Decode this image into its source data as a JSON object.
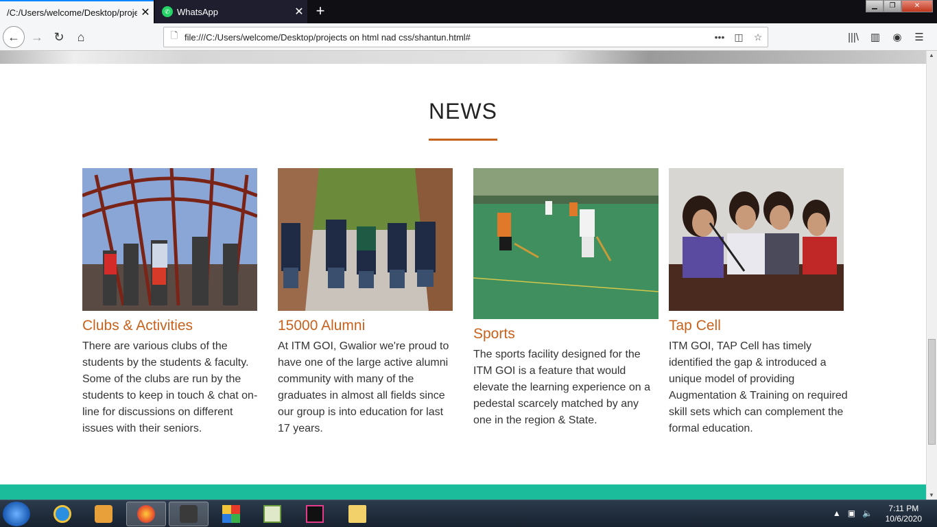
{
  "browser": {
    "tabs": [
      {
        "label": "/C:/Users/welcome/Desktop/projects"
      },
      {
        "label": "WhatsApp"
      }
    ],
    "url": "file:///C:/Users/welcome/Desktop/projects on html nad css/shantun.html#"
  },
  "news": {
    "heading": "NEWS",
    "cards": [
      {
        "title": "Clubs & Activities",
        "text": "There are various clubs of the students by the students & faculty. Some of the clubs are run by the students to keep in touch & chat on-line for discussions on different issues with their seniors."
      },
      {
        "title": "15000 Alumni",
        "text": "At ITM GOI, Gwalior we're proud to have one of the large active alumni community with many of the graduates in almost all fields since our group is into education for last 17 years."
      },
      {
        "title": "Sports",
        "text": "The sports facility designed for the ITM GOI is a feature that would elevate the learning experience on a pedestal scarcely matched by any one in the region & State."
      },
      {
        "title": "Tap Cell",
        "text": "ITM GOI, TAP Cell has timely identified the gap & introduced a unique model of providing Augmentation & Training on required skill sets which can complement the formal education."
      }
    ]
  },
  "taskbar": {
    "time": "7:11 PM",
    "date": "10/6/2020"
  },
  "colors": {
    "accent": "#c8611c",
    "footer": "#1abc9c"
  }
}
